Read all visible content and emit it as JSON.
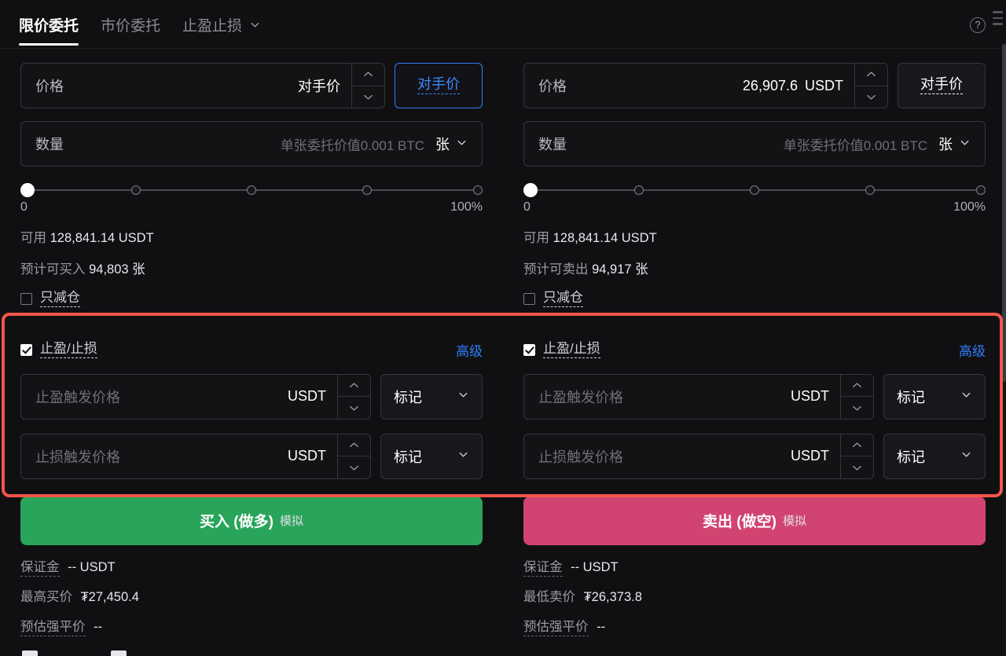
{
  "tabs": [
    {
      "label": "限价委托",
      "active": true
    },
    {
      "label": "市价委托",
      "active": false
    },
    {
      "label": "止盈止损",
      "active": false,
      "caret": true
    }
  ],
  "icons": {
    "help": "?",
    "caret_down": "chevron-down-icon",
    "spinner_up": "caret-up-icon",
    "spinner_down": "caret-down-icon"
  },
  "buy": {
    "price": {
      "label": "价格",
      "value": "对手价",
      "unit": ""
    },
    "price_mode_button": "对手价",
    "amount": {
      "label": "数量",
      "hint": "单张委托价值0.001 BTC",
      "unit": "张"
    },
    "slider": {
      "min_label": "0",
      "max_label": "100%",
      "value": 0,
      "marks": [
        0,
        25,
        50,
        75,
        100
      ]
    },
    "available_label": "可用",
    "available_value": "128,841.14 USDT",
    "estimate_label": "预计可买入",
    "estimate_value": "94,803 张",
    "reduce_only": "只减仓",
    "tpsl": {
      "title": "止盈/止损",
      "checked": true,
      "advanced": "高级",
      "tp_placeholder": "止盈触发价格",
      "tp_unit": "USDT",
      "tp_type": "标记",
      "sl_placeholder": "止损触发价格",
      "sl_unit": "USDT",
      "sl_type": "标记"
    },
    "action": "买入 (做多)",
    "action_sim": "模拟",
    "margin_label": "保证金",
    "margin_value": "-- USDT",
    "limit_label": "最高买价",
    "limit_value": "₮27,450.4",
    "liq_label": "预估强平价",
    "liq_value": "--"
  },
  "sell": {
    "price": {
      "label": "价格",
      "value": "26,907.6",
      "unit": "USDT"
    },
    "price_mode_button": "对手价",
    "amount": {
      "label": "数量",
      "hint": "单张委托价值0.001 BTC",
      "unit": "张"
    },
    "slider": {
      "min_label": "0",
      "max_label": "100%",
      "value": 0,
      "marks": [
        0,
        25,
        50,
        75,
        100
      ]
    },
    "available_label": "可用",
    "available_value": "128,841.14 USDT",
    "estimate_label": "预计可卖出",
    "estimate_value": "94,917 张",
    "reduce_only": "只减仓",
    "tpsl": {
      "title": "止盈/止损",
      "checked": true,
      "advanced": "高级",
      "tp_placeholder": "止盈触发价格",
      "tp_unit": "USDT",
      "tp_type": "标记",
      "sl_placeholder": "止损触发价格",
      "sl_unit": "USDT",
      "sl_type": "标记"
    },
    "action": "卖出 (做空)",
    "action_sim": "模拟",
    "margin_label": "保证金",
    "margin_value": "-- USDT",
    "limit_label": "最低卖价",
    "limit_value": "₮26,373.8",
    "liq_label": "预估强平价",
    "liq_value": "--"
  },
  "colors": {
    "buy_green": "#29a45b",
    "sell_pink": "#d14370",
    "accent_blue": "#2f7dfb",
    "highlight_red": "#f2574a",
    "background": "#101012"
  }
}
